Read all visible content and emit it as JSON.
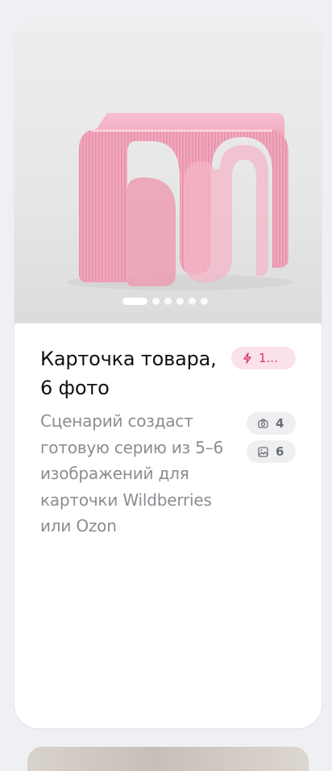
{
  "card": {
    "title": "Карточка товара, 6 фото",
    "description": "Сценарий создаст готовую серию из 5–6 изображений для карточки Wildberries или Ozon",
    "cost_badge": {
      "icon": "bolt-icon",
      "label": "1..."
    },
    "stats": [
      {
        "icon": "camera-icon",
        "value": "4"
      },
      {
        "icon": "image-icon",
        "value": "6"
      }
    ],
    "carousel": {
      "total": 6,
      "active": 1
    }
  },
  "colors": {
    "background": "#eef0f4",
    "card": "#ffffff",
    "accent": "#d63a6e",
    "accent_bg": "#fbe1ea",
    "muted_text": "#8a8c91",
    "product_pink": "#f2a9bf"
  }
}
